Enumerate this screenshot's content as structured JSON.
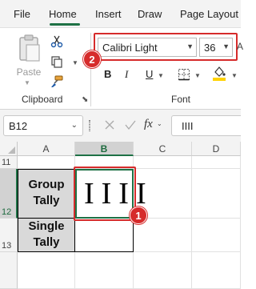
{
  "tabs": [
    "File",
    "Home",
    "Insert",
    "Draw",
    "Page Layout"
  ],
  "active_tab": "Home",
  "ribbon": {
    "clipboard": {
      "paste_label": "Paste",
      "group_label": "Clipboard"
    },
    "font": {
      "font_name": "Calibri Light",
      "font_size": "36",
      "bold_label": "B",
      "italic_label": "I",
      "underline_label": "U",
      "group_label": "Font"
    }
  },
  "formula_bar": {
    "name_box": "B12",
    "fx_label": "fx",
    "formula": "IIII"
  },
  "grid": {
    "columns": [
      "A",
      "B",
      "C",
      "D"
    ],
    "selected_column": "B",
    "rows": [
      "11",
      "12",
      "13"
    ],
    "selected_row": "12",
    "cells": {
      "A12": "Group Tally",
      "B12": "IIII",
      "A13": "Single Tally",
      "B13": ""
    }
  },
  "callouts": [
    "1",
    "2"
  ],
  "colors": {
    "accent": "#1e7145",
    "callout_red": "#d62b2b",
    "cell_fill": "#d9d9d9"
  }
}
